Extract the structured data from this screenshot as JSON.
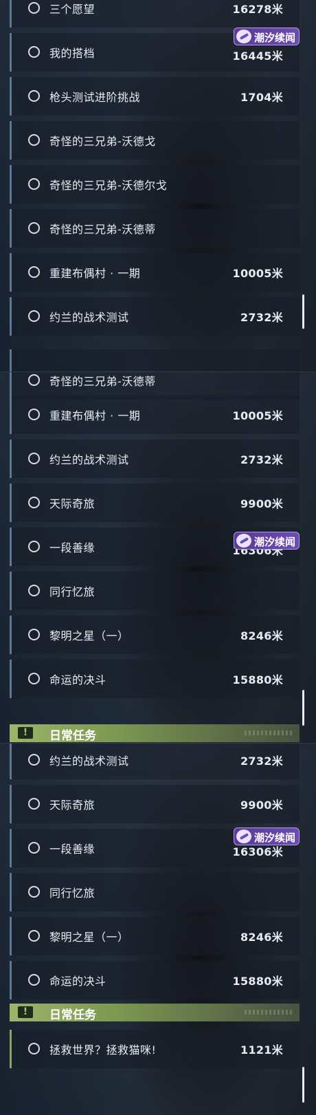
{
  "event_badge": {
    "label": "潮汐续闻"
  },
  "daily_section": {
    "label": "日常任务",
    "icon": "alert-icon"
  },
  "panel_1": {
    "rows": [
      {
        "name": "三个愿望",
        "distance": "16278米"
      },
      {
        "name": "我的搭档",
        "distance": "16445米"
      },
      {
        "name": "枪头测试进阶挑战",
        "distance": "1704米"
      },
      {
        "name": "奇怪的三兄弟-沃德戈",
        "distance": ""
      },
      {
        "name": "奇怪的三兄弟-沃德尔戈",
        "distance": ""
      },
      {
        "name": "奇怪的三兄弟-沃德蒂",
        "distance": ""
      },
      {
        "name": "重建布偶村 · 一期",
        "distance": "10005米"
      },
      {
        "name": "约兰的战术测试",
        "distance": "2732米"
      }
    ]
  },
  "panel_2": {
    "rows": [
      {
        "name": "奇怪的三兄弟-沃德蒂",
        "distance": ""
      },
      {
        "name": "重建布偶村 · 一期",
        "distance": "10005米"
      },
      {
        "name": "约兰的战术测试",
        "distance": "2732米"
      },
      {
        "name": "天际奇旅",
        "distance": "9900米"
      },
      {
        "name": "一段善缘",
        "distance": "16306米"
      },
      {
        "name": "同行忆旅",
        "distance": ""
      },
      {
        "name": "黎明之星（一）",
        "distance": "8246米"
      },
      {
        "name": "命运的决斗",
        "distance": "15880米"
      }
    ]
  },
  "panel_3": {
    "rows": [
      {
        "name": "约兰的战术测试",
        "distance": "2732米"
      },
      {
        "name": "天际奇旅",
        "distance": "9900米"
      },
      {
        "name": "一段善缘",
        "distance": "16306米"
      },
      {
        "name": "同行忆旅",
        "distance": ""
      },
      {
        "name": "黎明之星（一）",
        "distance": "8246米"
      },
      {
        "name": "命运的决斗",
        "distance": "15880米"
      }
    ],
    "daily_rows": [
      {
        "name": "拯救世界？拯救猫咪!",
        "distance": "1121米"
      }
    ]
  }
}
